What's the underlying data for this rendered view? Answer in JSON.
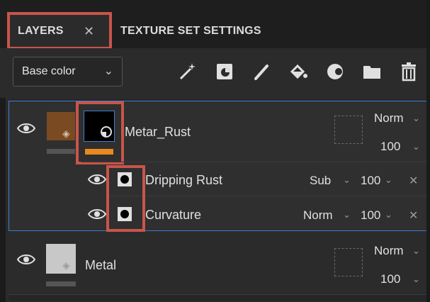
{
  "tabs": {
    "layers": "LAYERS",
    "texture_set_settings": "TEXTURE SET SETTINGS",
    "close_glyph": "✕"
  },
  "toolbar": {
    "channel_select": "Base color",
    "tools": [
      "magic-wand-icon",
      "fill-layer-icon",
      "paint-brush-icon",
      "paint-bucket-icon",
      "smart-material-icon",
      "folder-icon",
      "trash-icon"
    ]
  },
  "layers": [
    {
      "name": "Metar_Rust",
      "blend_mode": "Norm",
      "opacity": "100",
      "thumb_color": "#7a4a23",
      "mask_bar_color": "#e88a20",
      "effects": [
        {
          "name": "Dripping Rust",
          "blend_mode": "Sub",
          "opacity": "100"
        },
        {
          "name": "Curvature",
          "blend_mode": "Norm",
          "opacity": "100"
        }
      ]
    },
    {
      "name": "Metal",
      "blend_mode": "Norm",
      "opacity": "100",
      "thumb_color": "#c8c8c8"
    }
  ],
  "colors": {
    "highlight": "#c8554a",
    "selection": "#3d7fd0"
  }
}
